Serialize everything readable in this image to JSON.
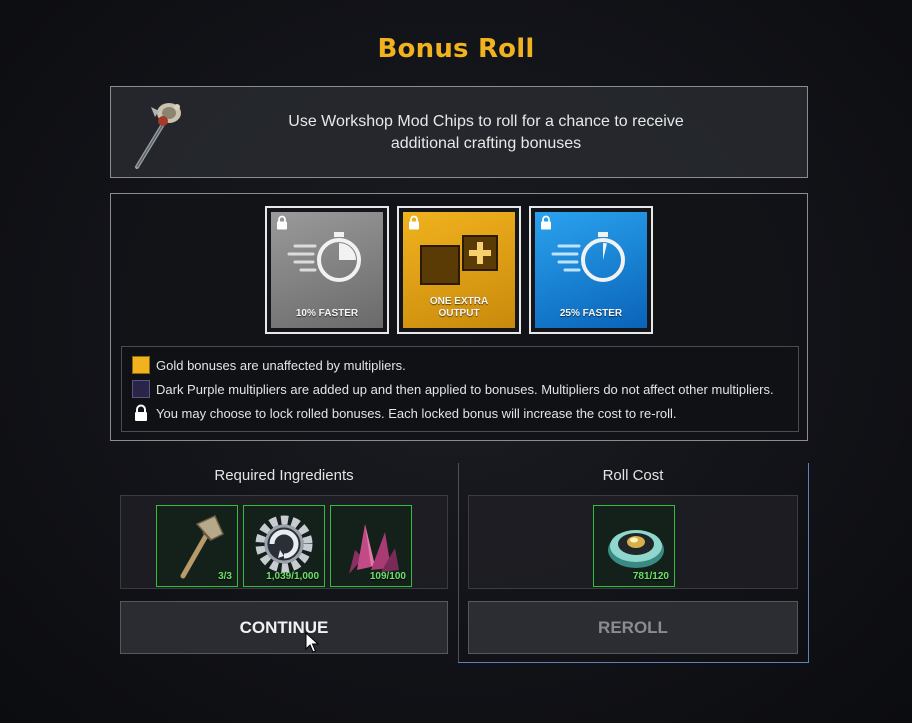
{
  "title": "Bonus Roll",
  "info": {
    "text_line1": "Use Workshop Mod Chips to roll for a chance to receive",
    "text_line2": "additional crafting bonuses",
    "icon": "mace-icon"
  },
  "bonus_cards": [
    {
      "label": "10% FASTER",
      "style": "gray",
      "icon": "stopwatch-icon",
      "locked": true
    },
    {
      "label_line1": "ONE EXTRA",
      "label_line2": "OUTPUT",
      "style": "gold",
      "icon": "extra-output-icon",
      "locked": true
    },
    {
      "label": "25% FASTER",
      "style": "blue",
      "icon": "stopwatch-icon",
      "locked": true
    }
  ],
  "legend": {
    "gold": "Gold bonuses are unaffected by multipliers.",
    "purple": "Dark Purple multipliers are added up and then applied to bonuses. Multipliers do not affect other multipliers.",
    "lock": "You may choose to lock rolled bonuses. Each locked bonus will increase the cost to re-roll."
  },
  "ingredients": {
    "title": "Required Ingredients",
    "items": [
      {
        "name": "axe-icon",
        "count": "3/3"
      },
      {
        "name": "gear-icon",
        "count": "1,039/1,000"
      },
      {
        "name": "crystal-icon",
        "count": "109/100"
      }
    ]
  },
  "roll_cost": {
    "title": "Roll Cost",
    "items": [
      {
        "name": "mod-chip-icon",
        "count": "781/120"
      }
    ]
  },
  "buttons": {
    "continue": "CONTINUE",
    "reroll": "REROLL"
  },
  "colors": {
    "title": "#f0b21f",
    "gold": "#f1b21e",
    "blue": "#1e8fe0",
    "gray": "#8a8a8a",
    "slot_border": "#2fbf3a",
    "count_text": "#6ce06a"
  }
}
